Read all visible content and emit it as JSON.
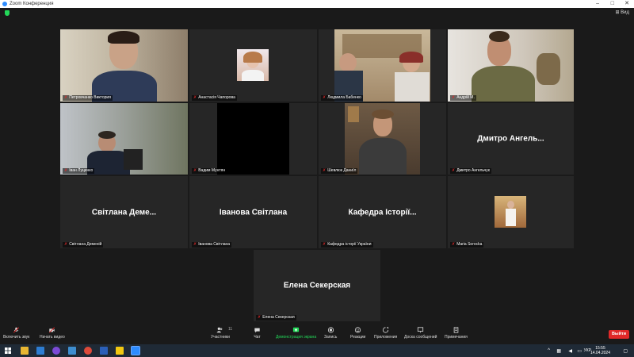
{
  "window": {
    "title": "Zoom Конференция",
    "minimize": "–",
    "maximize": "□",
    "close": "✕"
  },
  "view_button": "Вид",
  "tiles": [
    {
      "name": "Петровчанко Виктория",
      "type": "video"
    },
    {
      "name": "Анастасія Чапорова",
      "type": "photo"
    },
    {
      "name": "Людмила Бабенко",
      "type": "video"
    },
    {
      "name": "Андрій М.",
      "type": "video"
    },
    {
      "name": "Іван Луценко",
      "type": "video"
    },
    {
      "name": "Вадим Мунтян",
      "type": "black"
    },
    {
      "name": "Шевлюк Даниїл",
      "type": "video"
    },
    {
      "name": "Дмитро Ангельчук",
      "type": "name",
      "display": "Дмитро Ангель..."
    },
    {
      "name": "Світлана Деменій",
      "type": "name",
      "display": "Світлана Деме..."
    },
    {
      "name": "Іванова Світлана",
      "type": "name",
      "display": "Іванова Світлана"
    },
    {
      "name": "Кафедра історії України",
      "type": "name",
      "display": "Кафедра Історії..."
    },
    {
      "name": "Maria Sorocka",
      "type": "photo"
    },
    {
      "name": "Елена Секерская",
      "type": "name",
      "display": "Елена Секерская"
    }
  ],
  "toolbar": {
    "mute": "Включить звук",
    "video": "Начать видео",
    "participants": "Участники",
    "participants_count": "11",
    "chat": "Чат",
    "share": "Демонстрация экрана",
    "record": "Запись",
    "reactions": "Реакции",
    "apps": "Приложения",
    "whiteboard": "Доска сообщений",
    "notes": "Примечания",
    "leave": "Выйти"
  },
  "taskbar": {
    "lang": "УКР",
    "time": "15:55",
    "date": "14.04.2024"
  },
  "colors": {
    "active_speaker": "#b8e34a",
    "share_green": "#23d959",
    "leave_red": "#e02828",
    "taskbar": "#1f2a36"
  }
}
